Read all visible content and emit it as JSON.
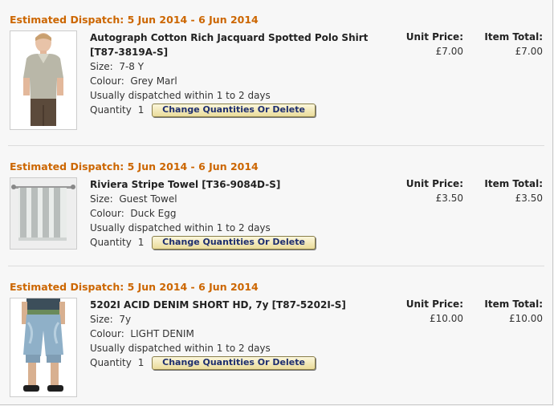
{
  "labels": {
    "size": "Size:",
    "colour": "Colour:",
    "quantity": "Quantity",
    "unit_price": "Unit Price:",
    "item_total": "Item Total:",
    "change_button": "Change Quantities Or Delete"
  },
  "items": [
    {
      "dispatch": "Estimated Dispatch: 5 Jun 2014 - 6 Jun 2014",
      "title_line1": "Autograph Cotton Rich Jacquard Spotted Polo Shirt",
      "title_line2": "[T87-3819A-S]",
      "size": "7-8 Y",
      "colour": "Grey Marl",
      "availability": "Usually dispatched within 1 to 2 days",
      "quantity": "1",
      "unit_price": "£7.00",
      "item_total": "£7.00"
    },
    {
      "dispatch": "Estimated Dispatch: 5 Jun 2014 - 6 Jun 2014",
      "title_line1": "Riviera Stripe Towel [T36-9084D-S]",
      "size": "Guest Towel",
      "colour": "Duck Egg",
      "availability": "Usually dispatched within 1 to 2 days",
      "quantity": "1",
      "unit_price": "£3.50",
      "item_total": "£3.50"
    },
    {
      "dispatch": "Estimated Dispatch: 5 Jun 2014 - 6 Jun 2014",
      "title_line1": "5202I ACID DENIM SHORT HD, 7y [T87-5202I-S]",
      "size": "7y",
      "colour": "LIGHT DENIM",
      "availability": "Usually dispatched within 1 to 2 days",
      "quantity": "1",
      "unit_price": "£10.00",
      "item_total": "£10.00"
    }
  ]
}
